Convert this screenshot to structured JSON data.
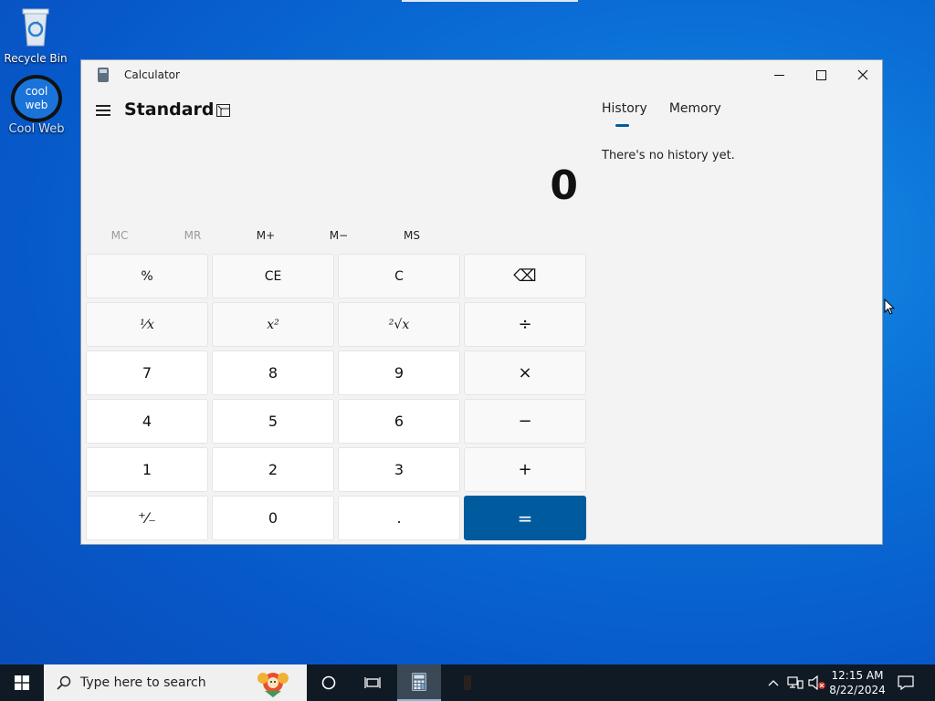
{
  "desktop": {
    "icons": [
      {
        "label": "Recycle Bin",
        "icon": "recycle-bin-icon"
      },
      {
        "label": "Cool Web",
        "icon": "cool-web-icon",
        "badge_text_1": "cool",
        "badge_text_2": "web"
      }
    ]
  },
  "window": {
    "title": "Calculator",
    "mode": "Standard",
    "display_value": "0",
    "memory_buttons": [
      {
        "label": "MC",
        "enabled": false
      },
      {
        "label": "MR",
        "enabled": false
      },
      {
        "label": "M+",
        "enabled": true
      },
      {
        "label": "M−",
        "enabled": true
      },
      {
        "label": "MS",
        "enabled": true
      }
    ],
    "keys": [
      "%",
      "CE",
      "C",
      "⌫",
      "¹⁄x",
      "x²",
      "²√x",
      "÷",
      "7",
      "8",
      "9",
      "×",
      "4",
      "5",
      "6",
      "−",
      "1",
      "2",
      "3",
      "+",
      "⁺⁄₋",
      "0",
      ".",
      "="
    ],
    "panel_tabs": [
      "History",
      "Memory"
    ],
    "active_tab": "History",
    "history_empty_message": "There's no history yet."
  },
  "taskbar": {
    "search_placeholder": "Type here to search",
    "clock_time": "12:15 AM",
    "clock_date": "8/22/2024"
  },
  "colors": {
    "accent": "#005a9e",
    "window_bg": "#f3f3f3",
    "taskbar_bg": "#101a24"
  }
}
